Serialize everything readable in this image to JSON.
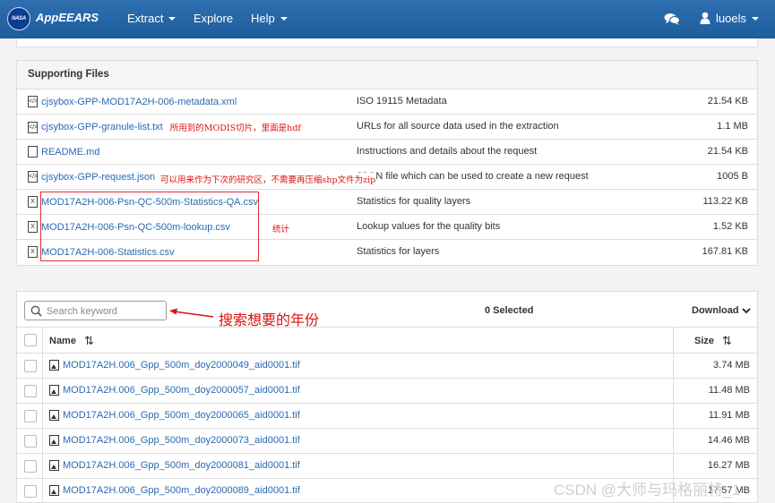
{
  "nav": {
    "brand": "AppEEARS",
    "logo_text": "NASA",
    "menu": [
      {
        "label": "Extract"
      },
      {
        "label": "Explore"
      },
      {
        "label": "Help"
      }
    ],
    "user": "luoels"
  },
  "supporting_files": {
    "title": "Supporting Files",
    "rows": [
      {
        "name": "cjsybox-GPP-MOD17A2H-006-metadata.xml",
        "description": "ISO 19115 Metadata",
        "size": "21.54 KB",
        "icon": "code-file-icon"
      },
      {
        "name": "cjsybox-GPP-granule-list.txt",
        "description": "URLs for all source data used in the extraction",
        "size": "1.1 MB",
        "icon": "code-file-icon",
        "note": "所用到的MODIS切片，里面是hdf"
      },
      {
        "name": "README.md",
        "description": "Instructions and details about the request",
        "size": "21.54 KB",
        "icon": "file-icon"
      },
      {
        "name": "cjsybox-GPP-request.json",
        "description": "JSON file which can be used to create a new request",
        "size": "1005 B",
        "icon": "code-file-icon",
        "note": "可以用来作为下次的研究区，不需要再压缩shp文件为zip"
      },
      {
        "name": "MOD17A2H-006-Psn-QC-500m-Statistics-QA.csv",
        "description": "Statistics for quality layers",
        "size": "113.22 KB",
        "icon": "excel-file-icon"
      },
      {
        "name": "MOD17A2H-006-Psn-QC-500m-lookup.csv",
        "description": "Lookup values for the quality bits",
        "size": "1.52 KB",
        "icon": "excel-file-icon"
      },
      {
        "name": "MOD17A2H-006-Statistics.csv",
        "description": "Statistics for layers",
        "size": "167.81 KB",
        "icon": "excel-file-icon"
      }
    ],
    "box_note": "统计"
  },
  "files": {
    "search_placeholder": "Search keyword",
    "selected": "0 Selected",
    "download": "Download",
    "columns": {
      "name": "Name",
      "size": "Size"
    },
    "rows": [
      {
        "name": "MOD17A2H.006_Gpp_500m_doy2000049_aid0001.tif",
        "size": "3.74 MB"
      },
      {
        "name": "MOD17A2H.006_Gpp_500m_doy2000057_aid0001.tif",
        "size": "11.48 MB"
      },
      {
        "name": "MOD17A2H.006_Gpp_500m_doy2000065_aid0001.tif",
        "size": "11.91 MB"
      },
      {
        "name": "MOD17A2H.006_Gpp_500m_doy2000073_aid0001.tif",
        "size": "14.46 MB"
      },
      {
        "name": "MOD17A2H.006_Gpp_500m_doy2000081_aid0001.tif",
        "size": "16.27 MB"
      },
      {
        "name": "MOD17A2H.006_Gpp_500m_doy2000089_aid0001.tif",
        "size": "17.57 MB"
      }
    ]
  },
  "annotation": "搜索想要的年份",
  "watermark": "CSDN @大师与玛格丽特_1",
  "colors": {
    "nav": "#1d5d9c",
    "link": "#2a6ab0",
    "annotation": "#dd1111"
  }
}
